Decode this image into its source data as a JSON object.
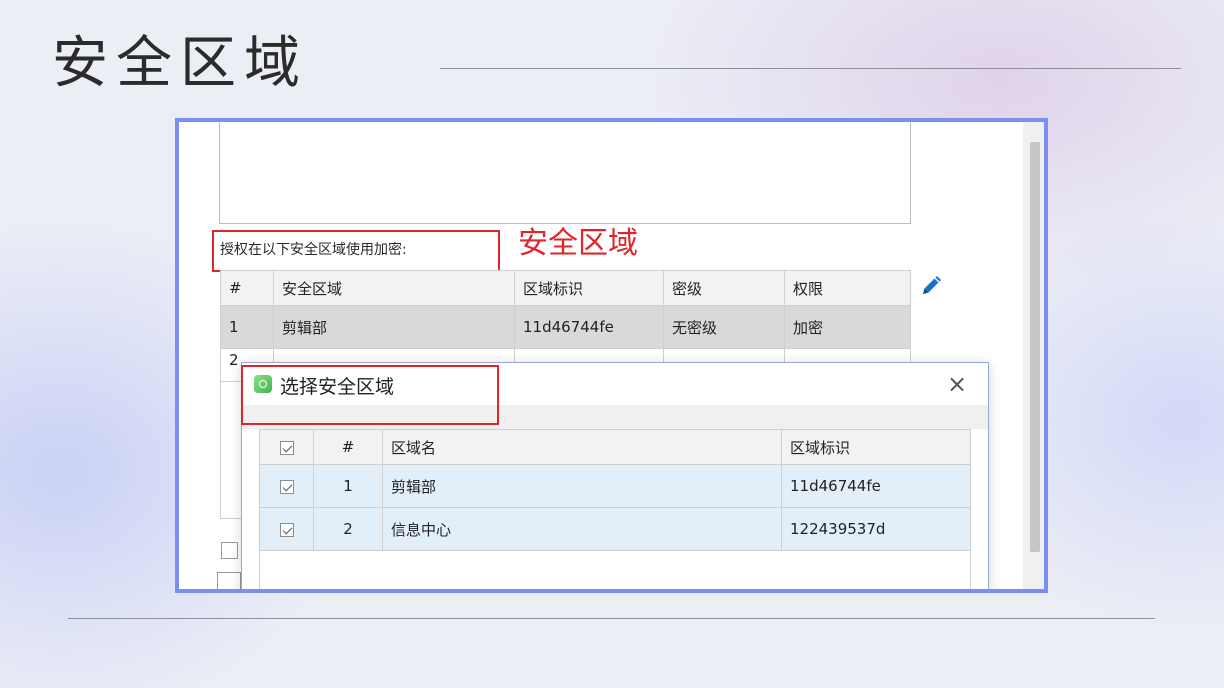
{
  "slide": {
    "title": "安全区域"
  },
  "panel": {
    "auth_label": "授权在以下安全区域使用加密:",
    "annotation": "安全区域",
    "zone_table": {
      "headers": [
        "#",
        "安全区域",
        "区域标识",
        "密级",
        "权限"
      ],
      "rows": [
        [
          "1",
          "剪辑部",
          "11d46744fe",
          "无密级",
          "加密"
        ],
        [
          "2",
          "",
          "",
          "",
          ""
        ]
      ]
    },
    "edit_icon": "pencil-icon"
  },
  "dialog": {
    "title": "选择安全区域",
    "app_icon": "app-logo-icon",
    "close_glyph": "×",
    "headers": [
      "#",
      "区域名",
      "区域标识"
    ],
    "rows": [
      {
        "index": "1",
        "name": "剪辑部",
        "id": "11d46744fe",
        "checked": true
      },
      {
        "index": "2",
        "name": "信息中心",
        "id": "122439537d",
        "checked": true
      }
    ]
  },
  "colors": {
    "frame": "#7b8ff0",
    "highlight": "#e0262b",
    "row_selected": "#d9d9d9",
    "row_dialog": "#e3eff8"
  }
}
